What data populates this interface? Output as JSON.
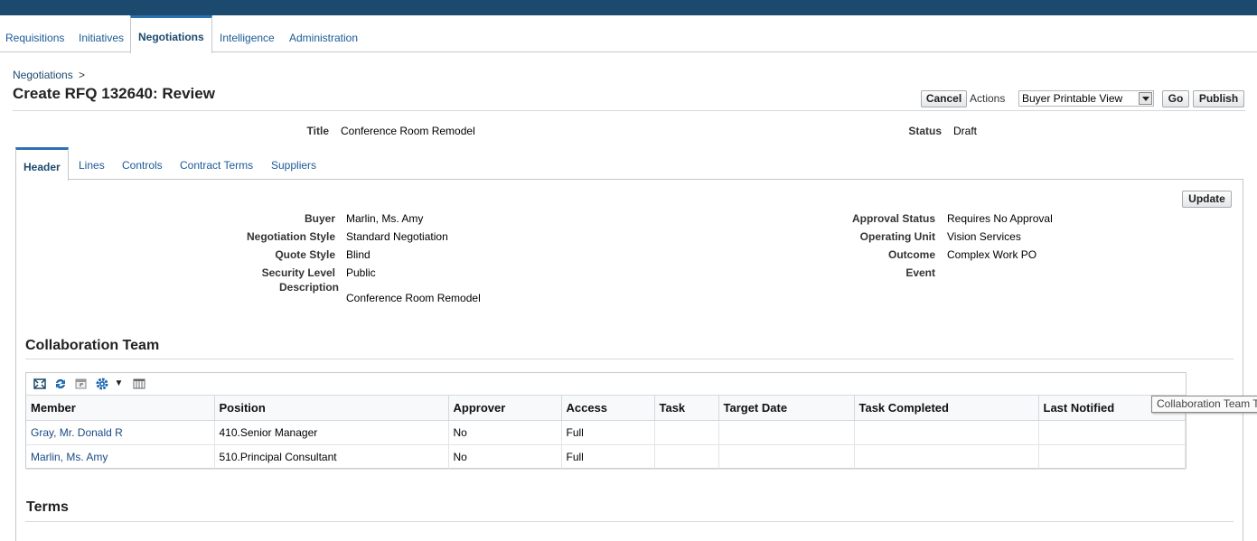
{
  "main_tabs": [
    "Requisitions",
    "Initiatives",
    "Negotiations",
    "Intelligence",
    "Administration"
  ],
  "breadcrumb": {
    "label": "Negotiations",
    "sep": ">"
  },
  "page_title": "Create RFQ 132640: Review",
  "actions": {
    "cancel": "Cancel",
    "actions_label": "Actions",
    "select_value": "Buyer Printable View",
    "go": "Go",
    "publish": "Publish"
  },
  "summary": {
    "title_label": "Title",
    "title_value": "Conference Room Remodel",
    "status_label": "Status",
    "status_value": "Draft"
  },
  "sub_tabs": [
    "Header",
    "Lines",
    "Controls",
    "Contract Terms",
    "Suppliers"
  ],
  "update": "Update",
  "header_left": [
    {
      "label": "Buyer",
      "value": "Marlin, Ms. Amy"
    },
    {
      "label": "Negotiation Style",
      "value": "Standard Negotiation"
    },
    {
      "label": "Quote Style",
      "value": "Blind"
    },
    {
      "label": "Security Level",
      "value": "Public"
    },
    {
      "label": "Description",
      "value": "Conference Room Remodel"
    }
  ],
  "header_right": [
    {
      "label": "Approval Status",
      "value": "Requires No Approval"
    },
    {
      "label": "Operating Unit",
      "value": "Vision Services"
    },
    {
      "label": "Outcome",
      "value": "Complex Work PO"
    },
    {
      "label": "Event",
      "value": ""
    }
  ],
  "collab": {
    "title": "Collaboration Team",
    "icons": [
      "detach-icon",
      "refresh-icon",
      "export-icon",
      "settings-icon",
      "columns-icon"
    ],
    "columns": [
      "Member",
      "Position",
      "Approver",
      "Access",
      "Task",
      "Target Date",
      "Task Completed",
      "Last Notified"
    ],
    "rows": [
      [
        "Gray, Mr. Donald R",
        "410.Senior Manager",
        "No",
        "Full",
        "",
        "",
        "",
        ""
      ],
      [
        "Marlin, Ms. Amy",
        "510.Principal Consultant",
        "No",
        "Full",
        "",
        "",
        "",
        ""
      ]
    ],
    "tooltip": "Collaboration Team T"
  },
  "terms_title": "Terms"
}
